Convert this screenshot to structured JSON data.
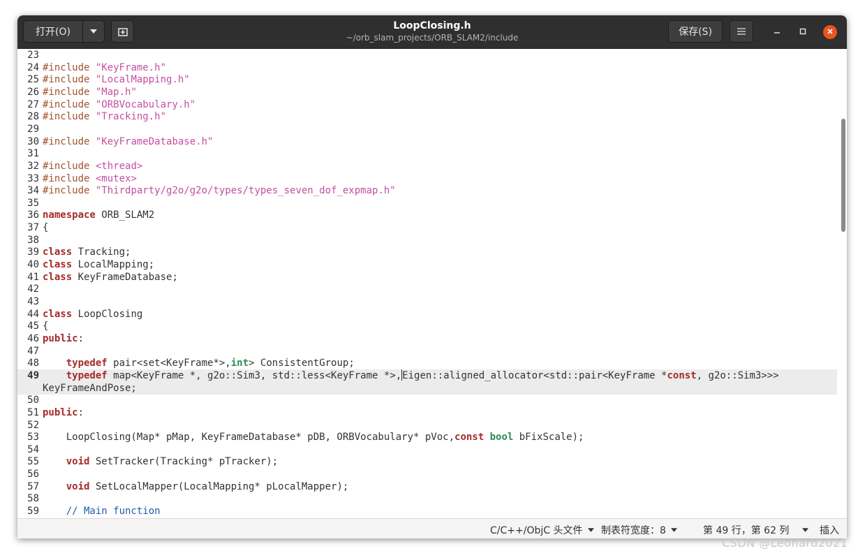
{
  "window": {
    "title": "LoopClosing.h",
    "subtitle": "~/orb_slam_projects/ORB_SLAM2/include"
  },
  "toolbar": {
    "open_label": "打开(O)",
    "open_menu_icon": "chevron-down-icon",
    "new_tab_icon": "new-document-icon",
    "save_label": "保存(S)",
    "menu_icon": "hamburger-menu-icon",
    "minimize_icon": "minimize-icon",
    "maximize_icon": "maximize-icon",
    "close_icon": "close-icon"
  },
  "editor": {
    "current_line": 49,
    "lines": [
      {
        "n": "23",
        "t": ""
      },
      {
        "n": "24",
        "t": "#include \"KeyFrame.h\""
      },
      {
        "n": "25",
        "t": "#include \"LocalMapping.h\""
      },
      {
        "n": "26",
        "t": "#include \"Map.h\""
      },
      {
        "n": "27",
        "t": "#include \"ORBVocabulary.h\""
      },
      {
        "n": "28",
        "t": "#include \"Tracking.h\""
      },
      {
        "n": "29",
        "t": ""
      },
      {
        "n": "30",
        "t": "#include \"KeyFrameDatabase.h\""
      },
      {
        "n": "31",
        "t": ""
      },
      {
        "n": "32",
        "t": "#include <thread>"
      },
      {
        "n": "33",
        "t": "#include <mutex>"
      },
      {
        "n": "34",
        "t": "#include \"Thirdparty/g2o/g2o/types/types_seven_dof_expmap.h\""
      },
      {
        "n": "35",
        "t": ""
      },
      {
        "n": "36",
        "t": "namespace ORB_SLAM2"
      },
      {
        "n": "37",
        "t": "{"
      },
      {
        "n": "38",
        "t": ""
      },
      {
        "n": "39",
        "t": "class Tracking;"
      },
      {
        "n": "40",
        "t": "class LocalMapping;"
      },
      {
        "n": "41",
        "t": "class KeyFrameDatabase;"
      },
      {
        "n": "42",
        "t": ""
      },
      {
        "n": "43",
        "t": ""
      },
      {
        "n": "44",
        "t": "class LoopClosing"
      },
      {
        "n": "45",
        "t": "{"
      },
      {
        "n": "46",
        "t": "public:"
      },
      {
        "n": "47",
        "t": ""
      },
      {
        "n": "48",
        "t": "    typedef pair<set<KeyFrame*>,int> ConsistentGroup;"
      },
      {
        "n": "49",
        "t": "    typedef map<KeyFrame *, g2o::Sim3, std::less<KeyFrame *>,Eigen::aligned_allocator<std::pair<KeyFrame *const, g2o::Sim3>>>"
      },
      {
        "n": "",
        "t": "KeyFrameAndPose;"
      },
      {
        "n": "50",
        "t": ""
      },
      {
        "n": "51",
        "t": "public:"
      },
      {
        "n": "52",
        "t": ""
      },
      {
        "n": "53",
        "t": "    LoopClosing(Map* pMap, KeyFrameDatabase* pDB, ORBVocabulary* pVoc,const bool bFixScale);"
      },
      {
        "n": "54",
        "t": ""
      },
      {
        "n": "55",
        "t": "    void SetTracker(Tracking* pTracker);"
      },
      {
        "n": "56",
        "t": ""
      },
      {
        "n": "57",
        "t": "    void SetLocalMapper(LocalMapping* pLocalMapper);"
      },
      {
        "n": "58",
        "t": ""
      },
      {
        "n": "59",
        "t": "    // Main function"
      }
    ]
  },
  "statusbar": {
    "language": "C/C++/ObjC 头文件",
    "tab_width": "制表符宽度：8",
    "position": "第 49 行，第 62 列",
    "mode": "插入"
  },
  "watermark": "CSDN @Leonard2021",
  "colors": {
    "titlebar": "#2f2f2f",
    "close_button": "#e95420",
    "preprocessor": "#a0522d",
    "string": "#c44fa0",
    "keyword": "#a52a2a",
    "type": "#2e8b57",
    "comment": "#1c5ea8",
    "current_line": "#ececec"
  }
}
